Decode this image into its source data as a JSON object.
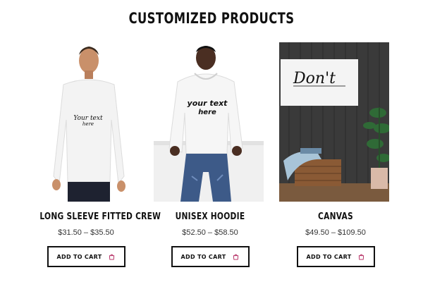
{
  "section": {
    "title": "CUSTOMIZED PRODUCTS"
  },
  "products": [
    {
      "name": "LONG SLEEVE FITTED CREW",
      "price": "$31.50 – $35.50",
      "cta": "ADD TO CART",
      "print_text": "Your text here",
      "image_icon": "model-long-sleeve-shirt"
    },
    {
      "name": "UNISEX HOODIE",
      "price": "$52.50 – $58.50",
      "cta": "ADD TO CART",
      "print_text": "your text here",
      "image_icon": "model-hoodie"
    },
    {
      "name": "CANVAS",
      "price": "$49.50 – $109.50",
      "cta": "ADD TO CART",
      "print_text": "Don't",
      "image_icon": "canvas-wall-art"
    }
  ],
  "colors": {
    "text": "#111111",
    "price": "#333333",
    "button_border": "#111111",
    "canvas_wall": "#3a3a3a"
  }
}
